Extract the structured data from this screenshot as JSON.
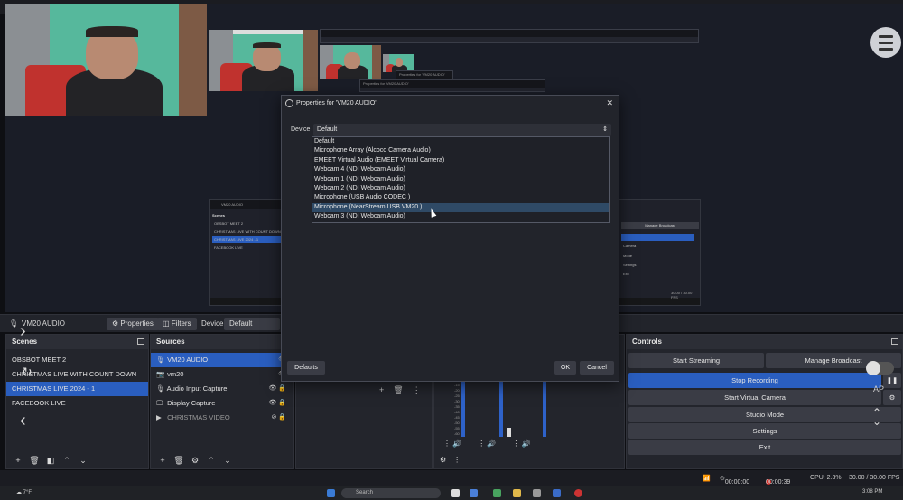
{
  "window": {
    "controls": [
      "—",
      "▢",
      "✕"
    ]
  },
  "preview": {
    "nested_titles": [
      "Properties for 'VM20 AUDIO'",
      "Properties for 'VM20 AUDIO'"
    ],
    "mini_dialog": {
      "title": "VM20 AUDIO",
      "scenes_header": "Scenes",
      "scenes": [
        "OBSBOT MEET 2",
        "CHRISTMAS LIVE WITH COUNT DOWN",
        "CHRISTMAS LIVE 2024 - 1",
        "FACEBOOK LIVE"
      ],
      "buttons": [
        "Manage Broadcast",
        "Camera",
        "Mode",
        "Settings",
        "Exit"
      ],
      "status": "30.00 / 30.00 FPS"
    }
  },
  "source_toolbar": {
    "source_name": "VM20 AUDIO",
    "properties_label": "Properties",
    "filters_label": "Filters",
    "device_label": "Device",
    "device_value": "Default"
  },
  "scenes": {
    "title": "Scenes",
    "items": [
      "OBSBOT MEET 2",
      "CHRISTMAS LIVE WITH COUNT DOWN",
      "CHRISTMAS LIVE 2024 - 1",
      "FACEBOOK LIVE"
    ],
    "selected_index": 2
  },
  "sources": {
    "title": "Sources",
    "items": [
      {
        "icon": "🎙",
        "label": "VM20 AUDIO"
      },
      {
        "icon": "📷",
        "label": "vm20"
      },
      {
        "icon": "🎙",
        "label": "Audio Input Capture"
      },
      {
        "icon": "🖵",
        "label": "Display Capture"
      },
      {
        "icon": "▶",
        "label": "CHRISTMAS VIDEO"
      }
    ]
  },
  "mixer": {
    "db_labels": [
      "-15",
      "-20",
      "-25",
      "-30",
      "-35",
      "-40",
      "-45",
      "-50",
      "-55",
      "-60"
    ]
  },
  "controls": {
    "title": "Controls",
    "start_streaming": "Start Streaming",
    "manage_broadcast": "Manage Broadcast",
    "stop_recording": "Stop Recording",
    "start_virtual_camera": "Start Virtual Camera",
    "studio_mode": "Studio Mode",
    "settings": "Settings",
    "exit": "Exit",
    "ap_label": "AP"
  },
  "status": {
    "stream_time": "00:00:00",
    "rec_time": "00:00:39",
    "cpu": "CPU: 2.3%",
    "fps": "30.00 / 30.00 FPS"
  },
  "taskbar": {
    "weather": "7°F",
    "search_placeholder": "Search",
    "time": "3:08 PM"
  },
  "dialog": {
    "title": "Properties for 'VM20 AUDIO'",
    "device_label": "Device",
    "device_value": "Default",
    "options": [
      "Default",
      "Microphone Array (Alcoco Camera Audio)",
      "EMEET Virtual Audio (EMEET Virtual Camera)",
      "Webcam 4 (NDI Webcam Audio)",
      "Webcam 1 (NDI Webcam Audio)",
      "Webcam 2 (NDI Webcam Audio)",
      "Microphone (USB Audio CODEC )",
      "Microphone (NearStream USB VM20 )",
      "Webcam 3 (NDI Webcam Audio)"
    ],
    "hover_index": 7,
    "defaults_label": "Defaults",
    "ok_label": "OK",
    "cancel_label": "Cancel"
  }
}
